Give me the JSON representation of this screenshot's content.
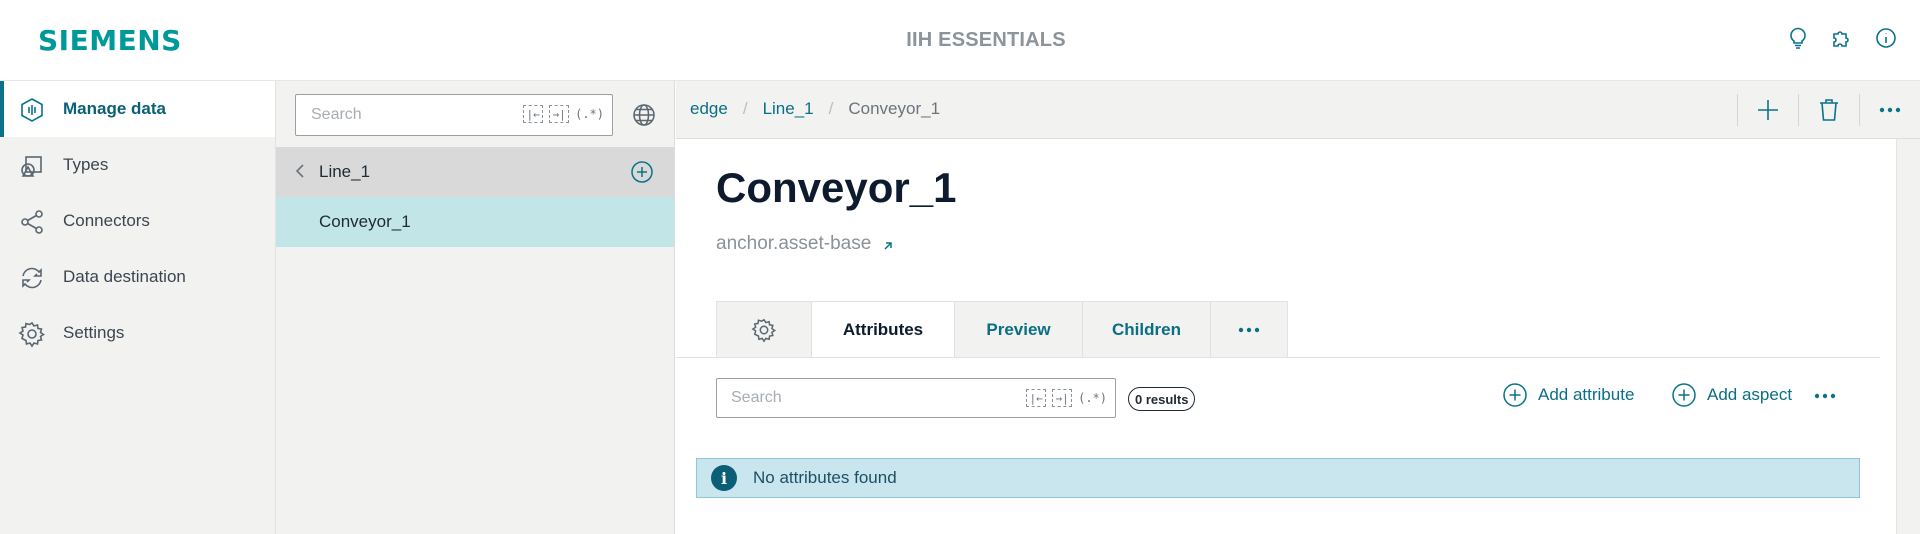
{
  "header": {
    "logo": "SIEMENS",
    "app_title": "IIH ESSENTIALS",
    "icons": [
      "lightbulb-icon",
      "puzzle-icon",
      "info-icon"
    ]
  },
  "nav": {
    "items": [
      {
        "label": "Manage data",
        "icon": "manage-data-icon",
        "active": true
      },
      {
        "label": "Types",
        "icon": "types-icon"
      },
      {
        "label": "Connectors",
        "icon": "connectors-icon"
      },
      {
        "label": "Data destination",
        "icon": "data-destination-icon"
      },
      {
        "label": "Settings",
        "icon": "gear-icon"
      }
    ]
  },
  "tree": {
    "search_placeholder": "Search",
    "regex_label": "(.*)",
    "parent": "Line_1",
    "child": "Conveyor_1"
  },
  "breadcrumb": {
    "items": [
      "edge",
      "Line_1",
      "Conveyor_1"
    ]
  },
  "asset": {
    "title": "Conveyor_1",
    "type": "anchor.asset-base"
  },
  "tabs": {
    "attributes": "Attributes",
    "preview": "Preview",
    "children": "Children"
  },
  "attributes": {
    "search_placeholder": "Search",
    "regex_label": "(.*)",
    "results": "0 results",
    "add_attribute": "Add attribute",
    "add_aspect": "Add aspect",
    "empty_message": "No attributes found"
  },
  "colors": {
    "brand": "#009999",
    "accent": "#0a7389",
    "selected_row": "#c2e5e8",
    "info_banner": "#c9e5ee"
  }
}
